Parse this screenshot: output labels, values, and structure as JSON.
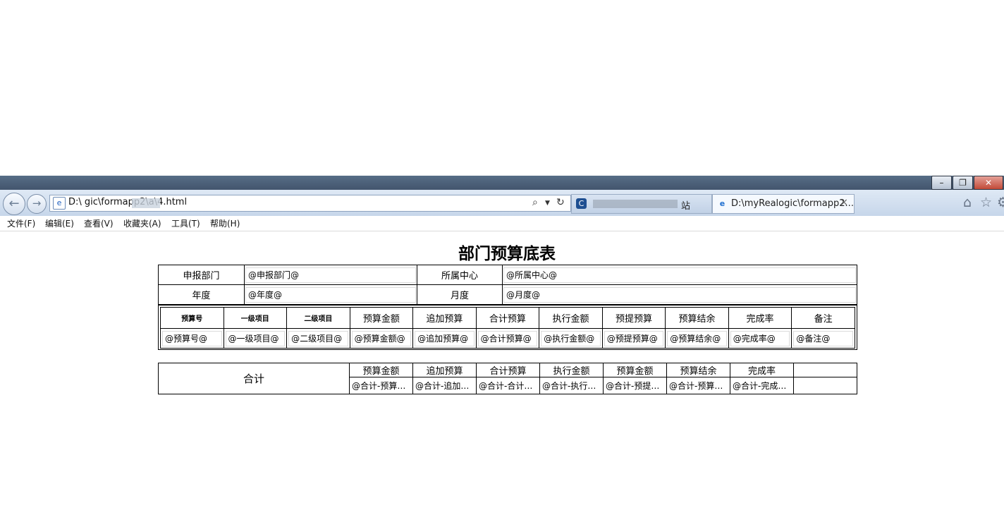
{
  "browser": {
    "address": "D:\\        gic\\formapp2\\a\\4.html",
    "tabs": [
      {
        "label": "站",
        "active": false
      },
      {
        "label": "D:\\myRealogic\\formapp2...",
        "active": true
      }
    ],
    "menu": [
      "文件(F)",
      "编辑(E)",
      "查看(V)",
      "收藏夹(A)",
      "工具(T)",
      "帮助(H)"
    ]
  },
  "form": {
    "title": "部门预算底表",
    "header_rows": [
      {
        "label1": "申报部门",
        "value1": "@申报部门@",
        "label2": "所属中心",
        "value2": "@所属中心@"
      },
      {
        "label1": "年度",
        "value1": "@年度@",
        "label2": "月度",
        "value2": "@月度@"
      }
    ],
    "detail_headers": [
      "预算号",
      "一级项目",
      "二级项目",
      "预算金额",
      "追加预算",
      "合计预算",
      "执行金额",
      "预提预算",
      "预算结余",
      "完成率",
      "备注"
    ],
    "detail_values": [
      "@预算号@",
      "@一级项目@",
      "@二级项目@",
      "@预算金额@",
      "@追加预算@",
      "@合计预算@",
      "@执行金额@",
      "@预提预算@",
      "@预算结余@",
      "@完成率@",
      "@备注@"
    ],
    "total_label": "合计",
    "total_headers": [
      "预算金额",
      "追加预算",
      "合计预算",
      "执行金额",
      "预算金额",
      "预算结余",
      "完成率",
      ""
    ],
    "total_values": [
      "@合计-预算…",
      "@合计-追加…",
      "@合计-合计…",
      "@合计-执行…",
      "@合计-预提…",
      "@合计-预算…",
      "@合计-完成…",
      ""
    ]
  }
}
